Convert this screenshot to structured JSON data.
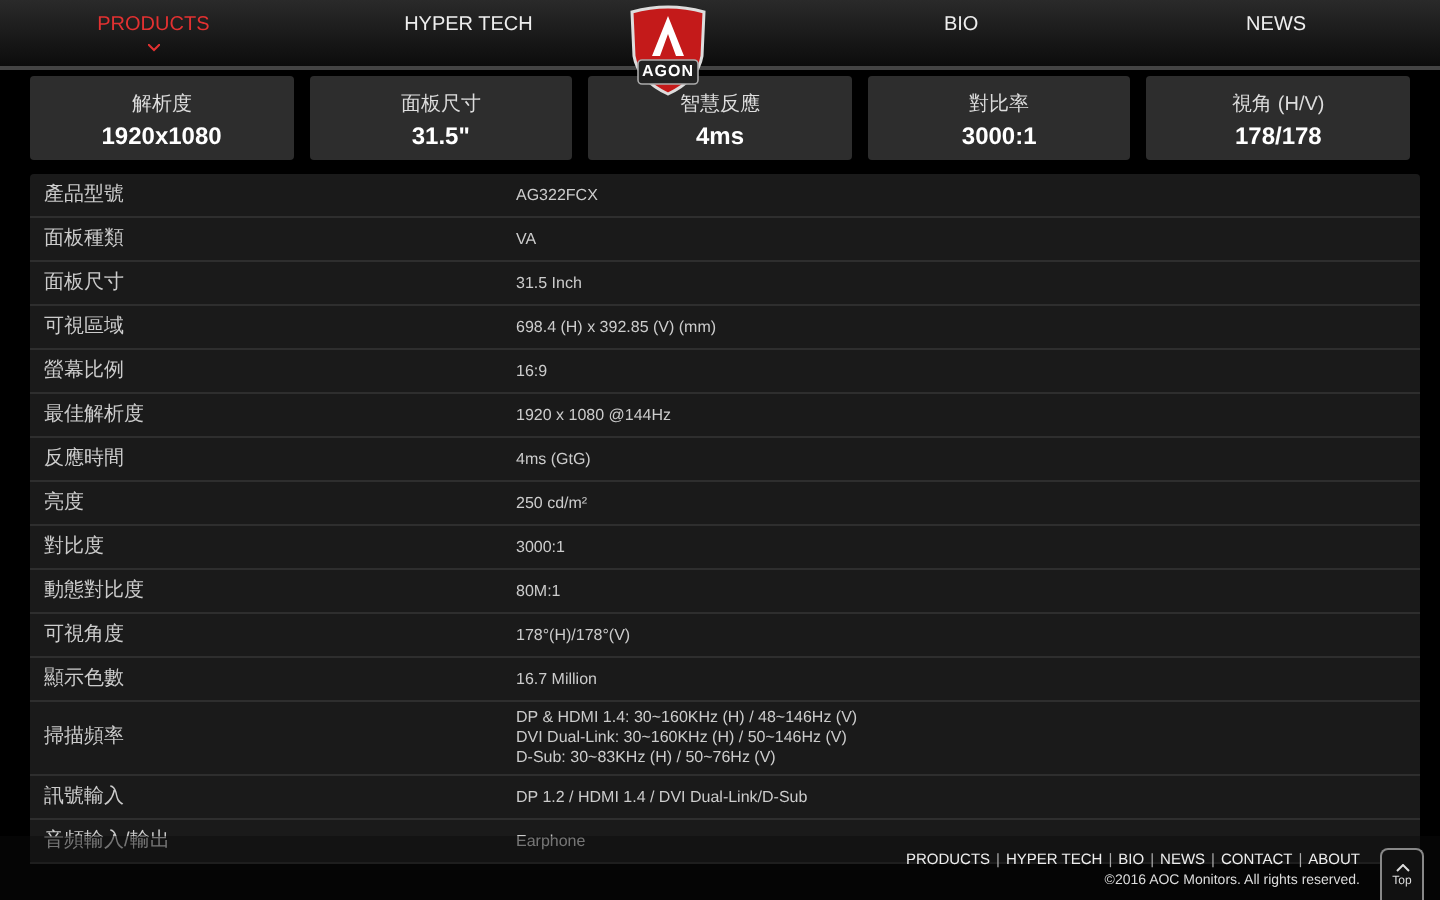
{
  "nav": {
    "items": [
      {
        "label": "PRODUCTS",
        "selected": true
      },
      {
        "label": "HYPER TECH",
        "selected": false
      },
      {
        "label": "BIO",
        "selected": false
      },
      {
        "label": "NEWS",
        "selected": false
      }
    ],
    "logo_text": "AGON"
  },
  "cards": [
    {
      "label": "解析度",
      "value": "1920x1080"
    },
    {
      "label": "面板尺寸",
      "value": "31.5\""
    },
    {
      "label": "智慧反應",
      "value": "4ms"
    },
    {
      "label": "對比率",
      "value": "3000:1"
    },
    {
      "label": "視角 (H/V)",
      "value": "178/178"
    }
  ],
  "specs": [
    {
      "label": "產品型號",
      "value": [
        "AG322FCX"
      ]
    },
    {
      "label": "面板種類",
      "value": [
        "VA"
      ]
    },
    {
      "label": "面板尺寸",
      "value": [
        "31.5 Inch"
      ]
    },
    {
      "label": "可視區域",
      "value": [
        "698.4 (H) x 392.85 (V) (mm)"
      ]
    },
    {
      "label": "螢幕比例",
      "value": [
        "16:9"
      ]
    },
    {
      "label": "最佳解析度",
      "value": [
        "1920 x 1080 @144Hz"
      ]
    },
    {
      "label": "反應時間",
      "value": [
        "4ms (GtG)"
      ]
    },
    {
      "label": "亮度",
      "value": [
        "250 cd/m²"
      ]
    },
    {
      "label": "對比度",
      "value": [
        "3000:1"
      ]
    },
    {
      "label": "動態對比度",
      "value": [
        "80M:1"
      ]
    },
    {
      "label": "可視角度",
      "value": [
        "178°(H)/178°(V)"
      ]
    },
    {
      "label": "顯示色數",
      "value": [
        "16.7 Million"
      ]
    },
    {
      "label": "掃描頻率",
      "value": [
        "DP & HDMI 1.4: 30~160KHz (H) / 48~146Hz (V)",
        "DVI Dual-Link: 30~160KHz (H) / 50~146Hz (V)",
        "D-Sub: 30~83KHz (H) / 50~76Hz (V)"
      ]
    },
    {
      "label": "訊號輸入",
      "value": [
        "DP 1.2 / HDMI 1.4 / DVI Dual-Link/D-Sub"
      ]
    },
    {
      "label": "音頻輸入/輸出",
      "value": [
        "Earphone"
      ]
    }
  ],
  "footer": {
    "links": [
      "PRODUCTS",
      "HYPER TECH",
      "BIO",
      "NEWS",
      "CONTACT",
      "ABOUT"
    ],
    "separator": "|",
    "copyright": "©2016 AOC Monitors. All rights reserved.",
    "top_button": "Top"
  }
}
